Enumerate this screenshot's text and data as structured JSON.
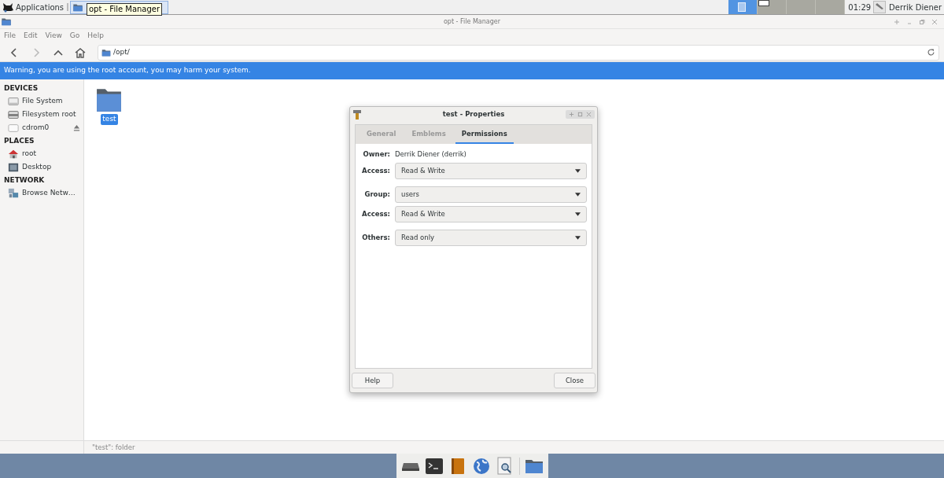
{
  "panel": {
    "applications": "Applications",
    "tooltip": "opt - File Manager",
    "workspaces": [
      {
        "selected": true
      },
      {
        "selected": false
      },
      {
        "selected": false
      },
      {
        "selected": false
      }
    ],
    "clock": "01:29",
    "user": "Derrik Diener"
  },
  "window": {
    "title": "opt - File Manager",
    "menu": [
      "File",
      "Edit",
      "View",
      "Go",
      "Help"
    ],
    "location": "/opt/",
    "warning": "Warning, you are using the root account, you may harm your system.",
    "sidebar": [
      {
        "heading": "DEVICES",
        "items": [
          {
            "label": "File System",
            "kind": "drive",
            "eject": false
          },
          {
            "label": "Filesystem root",
            "kind": "root-drive",
            "eject": false
          },
          {
            "label": "cdrom0",
            "kind": "disc",
            "eject": true
          }
        ]
      },
      {
        "heading": "PLACES",
        "items": [
          {
            "label": "root",
            "kind": "home",
            "eject": false
          },
          {
            "label": "Desktop",
            "kind": "desktop",
            "eject": false
          }
        ]
      },
      {
        "heading": "NETWORK",
        "items": [
          {
            "label": "Browse Netw…",
            "kind": "network",
            "eject": false
          }
        ]
      }
    ],
    "files": [
      {
        "label": "test",
        "selected": true
      }
    ],
    "status": "\"test\": folder"
  },
  "dialog": {
    "title": "test - Properties",
    "tabs": [
      {
        "label": "General",
        "selected": false
      },
      {
        "label": "Emblems",
        "selected": false
      },
      {
        "label": "Permissions",
        "selected": true
      }
    ],
    "owner_label": "Owner:",
    "owner": "Derrik Diener (derrik)",
    "rows": [
      {
        "label": "Access:",
        "value": "Read & Write"
      },
      {
        "label": "Group:",
        "value": "users"
      },
      {
        "label": "Access:",
        "value": "Read & Write"
      },
      {
        "label": "Others:",
        "value": "Read only"
      }
    ],
    "buttons": [
      "Help",
      "Close"
    ]
  }
}
